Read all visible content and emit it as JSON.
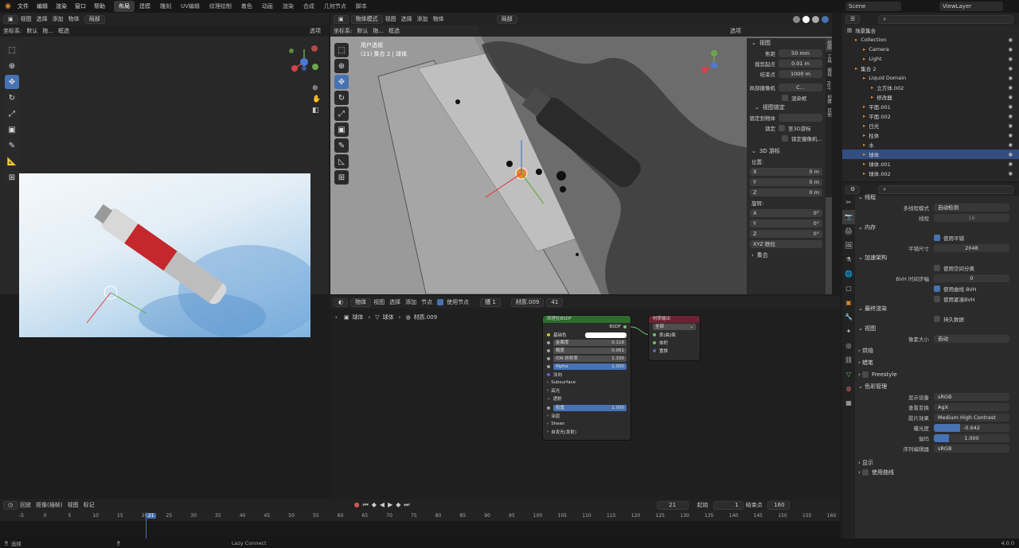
{
  "menu": [
    "文件",
    "编辑",
    "渲染",
    "窗口",
    "帮助"
  ],
  "workspaces": [
    "布局",
    "建模",
    "雕刻",
    "UV编辑",
    "纹理绘制",
    "着色",
    "动画",
    "渲染",
    "合成",
    "几何节点",
    "脚本"
  ],
  "active_workspace_index": 0,
  "scene": "Scene",
  "view_layer": "ViewLayer",
  "left_view": {
    "view": "视图",
    "select": "选择",
    "add": "添加",
    "object": "物体",
    "mode": "局部",
    "coord_label": "坐标系:",
    "coord_value": "默认",
    "drag": "拖...",
    "select_box": "框选",
    "options": "选项"
  },
  "viewport": {
    "mode": "物体模式",
    "view": "视图",
    "select": "选择",
    "add": "添加",
    "object": "物体",
    "local": "局部",
    "coord_label": "坐标系:",
    "coord_value": "默认",
    "drag": "拖...",
    "select_box": "框选",
    "options": "选项",
    "title": "用户透视",
    "subtitle": "(21) 集合 2 | 球体"
  },
  "n_panel": {
    "view_header": "视图",
    "focal_label": "焦距",
    "focal_value": "50 mm",
    "clip_start_label": "裁剪起点",
    "clip_start_value": "0.01 m",
    "clip_end_label": "结束点",
    "clip_end_value": "1000 m",
    "local_cam_label": "局部摄像机",
    "local_cam_value": "C...",
    "render_region": "渲染框",
    "view_lock": "视图锁定",
    "lock_to_object": "锁定到物体",
    "lock_label": "锁定",
    "to_3d_cursor": "至3D游标",
    "to_camera": "锁定摄像机...",
    "cursor_header": "3D 游标",
    "location": "位置:",
    "x": "X",
    "y": "Y",
    "z": "Z",
    "x_val": "0 m",
    "y_val": "0 m",
    "z_val": "0 m",
    "rotation": "旋转:",
    "rx": "0°",
    "ry": "0°",
    "rz": "0°",
    "rot_mode": "XYZ 欧拉",
    "collection": "集合",
    "tabs": [
      "视图",
      "工具",
      "编辑",
      "PDT",
      "创建",
      "其他"
    ]
  },
  "node_editor": {
    "mode": "物体",
    "view": "视图",
    "select": "选择",
    "add": "添加",
    "node": "节点",
    "use_nodes": "使用节点",
    "slot": "槽 1",
    "material": "材质.009",
    "users": "41",
    "breadcrumb": [
      "球体",
      "球体",
      "材质.009"
    ]
  },
  "bsdf_node": {
    "title": "原理化BSDF",
    "output": "BSDF",
    "base_color": "基础色",
    "metallic_label": "金属度",
    "metallic": "0.118",
    "roughness_label": "糙度",
    "roughness": "0.061",
    "ior_label": "IOR 折射率",
    "ior": "1.330",
    "alpha_label": "Alpha",
    "alpha": "1.000",
    "normal": "法向",
    "subsurface": "Subsurface",
    "specular": "高光",
    "transmission": "透射",
    "weight_label": "权重",
    "weight": "1.000",
    "coat": "涂层",
    "sheen": "Sheen",
    "emission": "自发光(发射)"
  },
  "output_node": {
    "title": "材质输出",
    "target": "全部",
    "surface": "表(曲)面",
    "volume": "体积",
    "displacement": "置换"
  },
  "outliner": {
    "root": "场景集合",
    "items": [
      {
        "name": "Collection",
        "indent": 1
      },
      {
        "name": "Camera",
        "indent": 2
      },
      {
        "name": "Light",
        "indent": 2
      },
      {
        "name": "集合 2",
        "indent": 1
      },
      {
        "name": "Liquid Domain",
        "indent": 2
      },
      {
        "name": "立方体.002",
        "indent": 3
      },
      {
        "name": "修改器",
        "indent": 3
      },
      {
        "name": "平面.001",
        "indent": 2
      },
      {
        "name": "平面.002",
        "indent": 2
      },
      {
        "name": "日光",
        "indent": 2
      },
      {
        "name": "柱体",
        "indent": 2
      },
      {
        "name": "水",
        "indent": 2
      },
      {
        "name": "球体",
        "indent": 2,
        "selected": true
      },
      {
        "name": "球体.001",
        "indent": 2
      },
      {
        "name": "球体.002",
        "indent": 2
      }
    ]
  },
  "properties": {
    "threads_section": "线程",
    "threads_mode_label": "多线程模式",
    "threads_mode": "自动检测",
    "threads_label": "线程",
    "threads": "16",
    "memory_section": "内存",
    "use_tiling": "使用平铺",
    "tile_size_label": "平铺尺寸",
    "tile_size": "2048",
    "accel_section": "加速架构",
    "spatial_split": "使用空间分离",
    "bvh_steps_label": "BVH 时间步幅",
    "bvh_steps": "0",
    "use_curve_bvh": "使用曲线 BVH",
    "compact_bvh": "使用紧凑BVH",
    "final_render_section": "最终渲染",
    "persistent_data": "持久数据",
    "viewport_section": "视图",
    "pixel_size_label": "像素大小",
    "pixel_size": "自动",
    "bake": "烘焙",
    "grease": "蜡笔",
    "freestyle": "Freestyle",
    "color_mgmt": "色彩管理",
    "display_device_label": "显示设备",
    "display_device": "sRGB",
    "view_transform_label": "查看变换",
    "view_transform": "AgX",
    "look_label": "胶片效果",
    "look": "Medium High Contrast",
    "exposure_label": "曝光度",
    "exposure": "-0.642",
    "gamma_label": "伽玛",
    "gamma": "1.000",
    "sequencer_label": "序列编辑器",
    "sequencer": "sRGB",
    "display": "显示",
    "use_curves": "使用曲线"
  },
  "timeline": {
    "playback": "回放",
    "keying": "抠像(插帧)",
    "view": "视图",
    "marker": "标记",
    "current_frame": "21",
    "start_label": "起始",
    "start": "1",
    "end_label": "结束点",
    "end": "160",
    "ticks": [
      "-5",
      "0",
      "5",
      "10",
      "15",
      "20",
      "21",
      "25",
      "30",
      "35",
      "40",
      "45",
      "50",
      "55",
      "60",
      "65",
      "70",
      "75",
      "80",
      "85",
      "90",
      "95",
      "100",
      "105",
      "110",
      "115",
      "120",
      "125",
      "130",
      "135",
      "140",
      "145",
      "150",
      "155",
      "160"
    ]
  },
  "status": {
    "left": "选择",
    "middle": "Lazy Connect",
    "version": "4.0.0"
  },
  "colors": {
    "accent": "#4772b3",
    "orange": "#e8882a",
    "panel": "#2b2b2b",
    "bg": "#1d1d1d"
  }
}
